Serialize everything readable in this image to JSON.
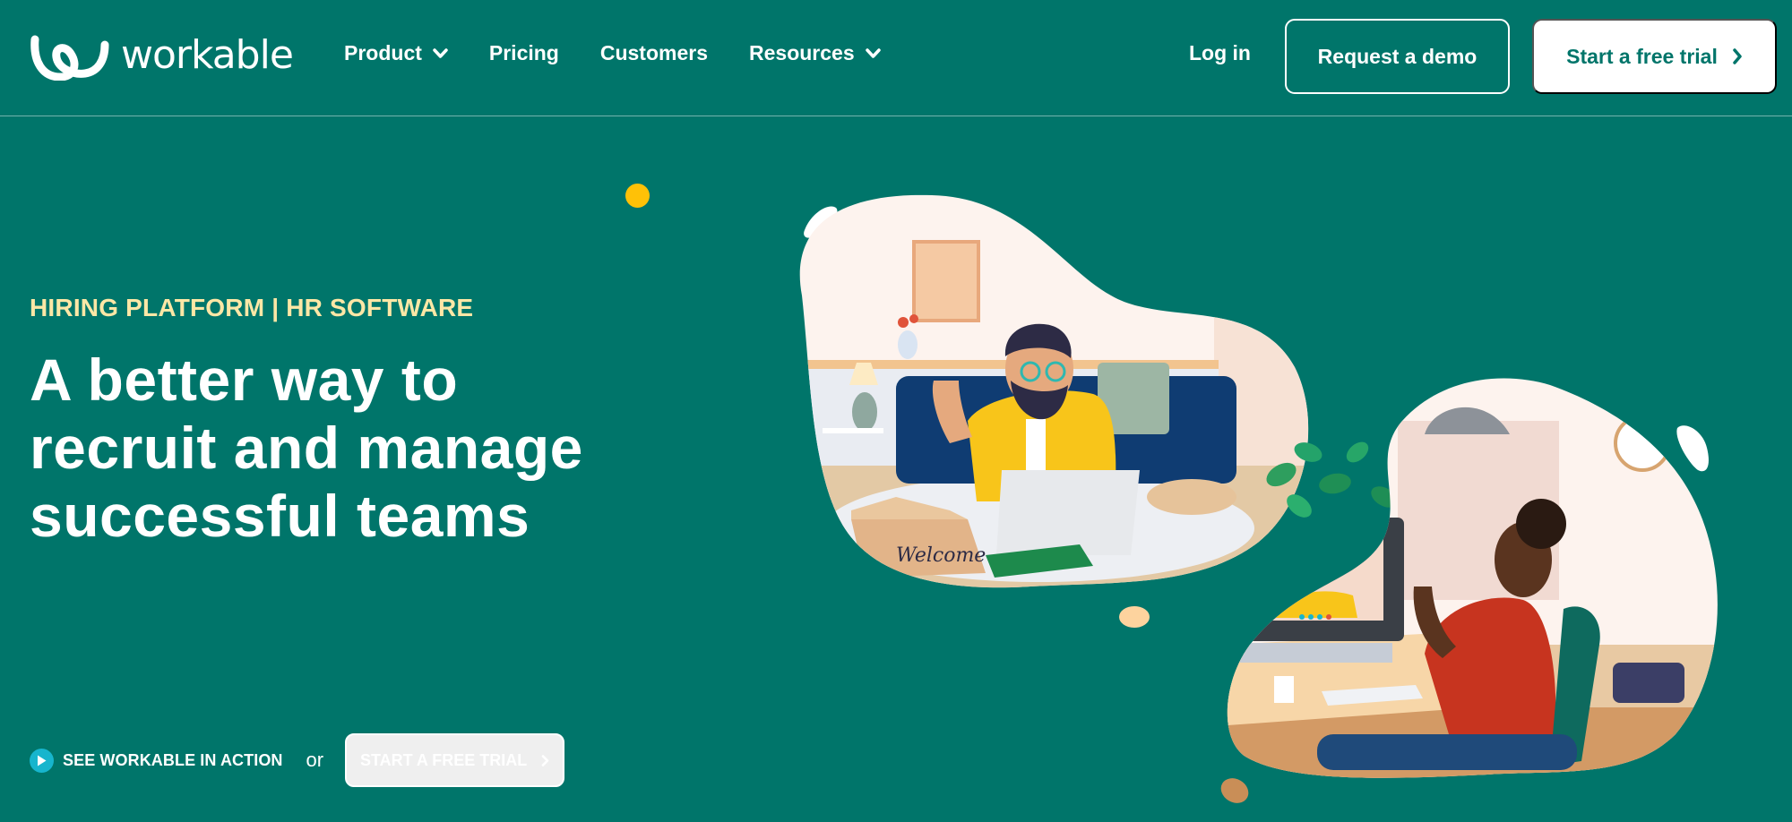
{
  "header": {
    "logo_text": "workable",
    "nav": [
      {
        "label": "Product",
        "has_dropdown": true
      },
      {
        "label": "Pricing",
        "has_dropdown": false
      },
      {
        "label": "Customers",
        "has_dropdown": false
      },
      {
        "label": "Resources",
        "has_dropdown": true
      }
    ],
    "login_label": "Log in",
    "demo_label": "Request a demo",
    "trial_label": "Start a free trial"
  },
  "hero": {
    "eyebrow": "HIRING PLATFORM | HR SOFTWARE",
    "headline_lines": [
      "A better way to",
      "recruit and manage",
      "successful teams"
    ],
    "see_action_label": "SEE WORKABLE IN ACTION",
    "or_label": "or",
    "cta_label": "START A FREE TRIAL"
  },
  "illustration": {
    "box_label": "Welcome",
    "alt": "Remote onboarding video call illustration"
  },
  "colors": {
    "background": "#00756A",
    "accent_yellow": "#FCE7A6",
    "dot_yellow": "#FFC107",
    "play_cyan": "#17B5CD"
  }
}
